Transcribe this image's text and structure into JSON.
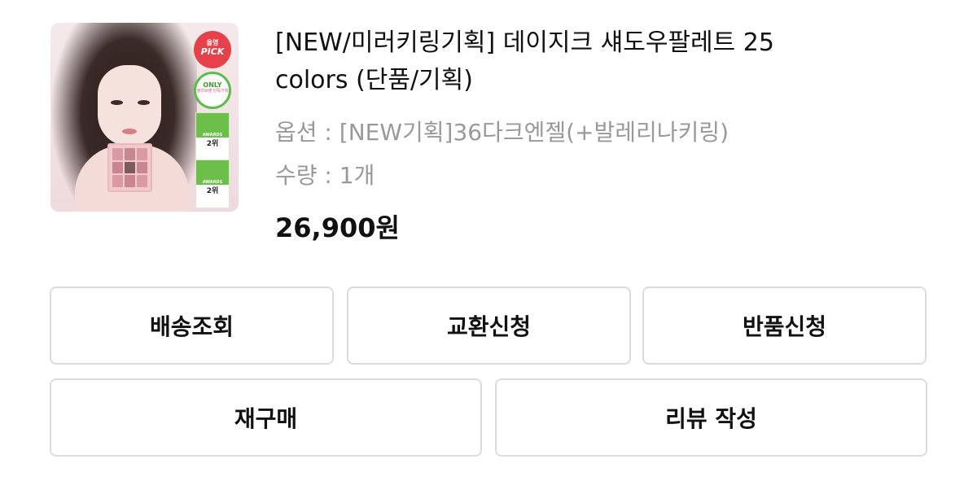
{
  "product": {
    "title": "[NEW/미러키링기획] 데이지크 섀도우팔레트 25 colors (단품/기획)",
    "option_label": "옵션",
    "option_value": "[NEW기획]36다크엔젤(+발레리나키링)",
    "quantity_label": "수량",
    "quantity_value": "1개",
    "price": "26,900",
    "currency": "원",
    "thumbnail": {
      "badge_pick_top": "올영",
      "badge_pick_bottom": "PICK",
      "badge_only_top": "ONLY",
      "badge_only_bottom": "올리브영 단독기획",
      "award_label": "AWARDS",
      "award_rank": "2위"
    }
  },
  "actions": {
    "delivery": "배송조회",
    "exchange": "교환신청",
    "return": "반품신청",
    "repurchase": "재구매",
    "review": "리뷰 작성"
  },
  "colors": {
    "text": "#111111",
    "meta": "#999999",
    "button_border": "#dcdcdc",
    "pick_badge": "#e6414b",
    "only_badge": "#5bbd4b"
  }
}
